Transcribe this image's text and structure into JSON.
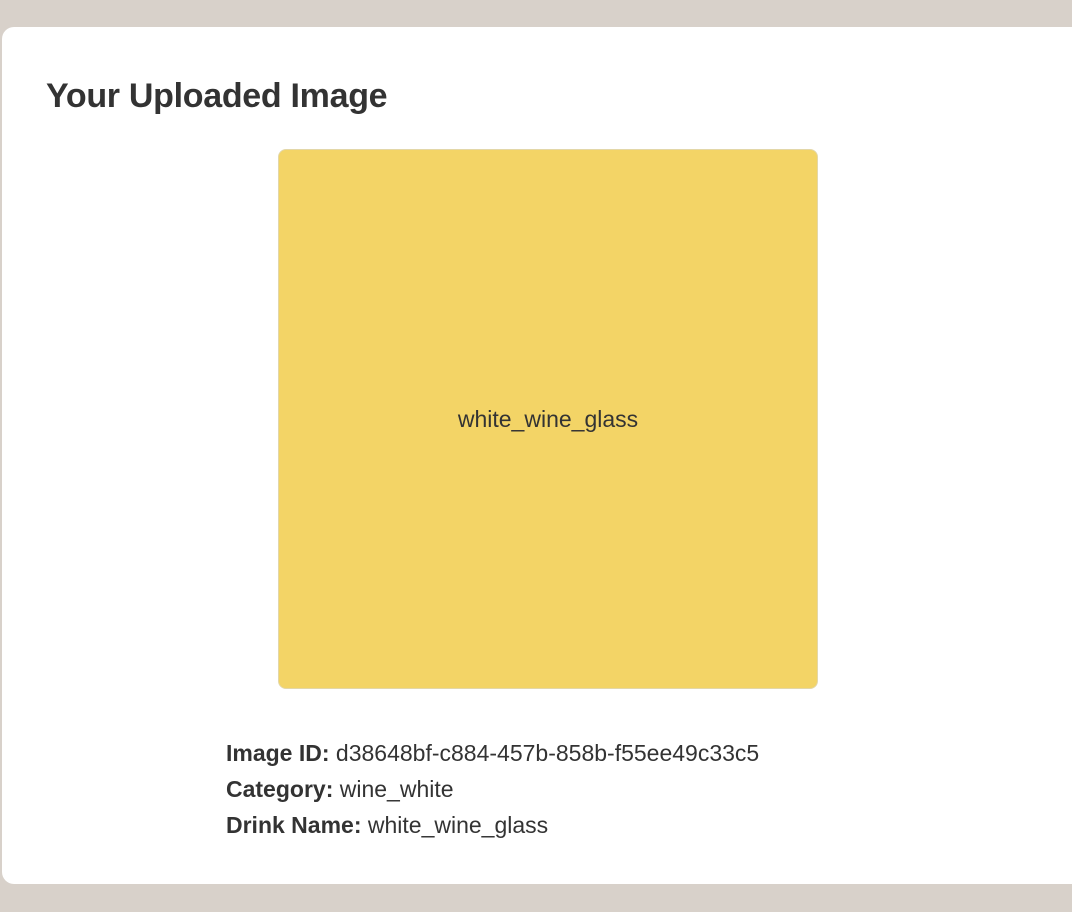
{
  "upload": {
    "title": "Your Uploaded Image",
    "preview": {
      "label": "white_wine_glass",
      "background_color": "#f3d466"
    },
    "details": [
      {
        "label": "Image ID:",
        "value": "d38648bf-c884-457b-858b-f55ee49c33c5"
      },
      {
        "label": "Category:",
        "value": "wine_white"
      },
      {
        "label": "Drink Name:",
        "value": "white_wine_glass"
      }
    ]
  },
  "colors": {
    "page_background": "#d8d1ca",
    "card_background": "#ffffff",
    "text": "#333333"
  }
}
